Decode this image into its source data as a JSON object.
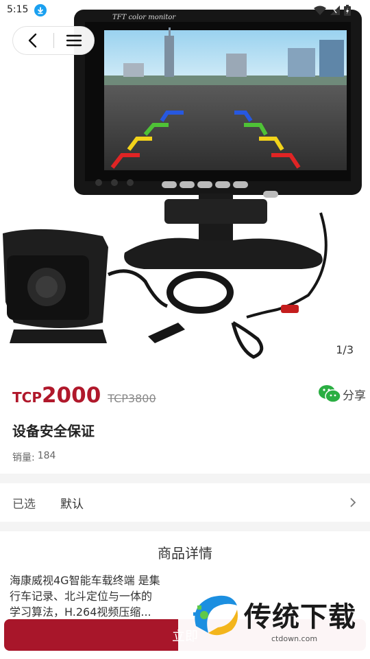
{
  "status_bar": {
    "time": "5:15",
    "icons": [
      "download-icon",
      "wifi-icon",
      "signal-icon",
      "battery-icon"
    ]
  },
  "nav": {
    "back_icon": "chevron-left-icon",
    "menu_icon": "menu-icon"
  },
  "hero": {
    "monitor_label": "TFT color monitor",
    "image_counter": "1/3"
  },
  "product": {
    "currency": "TCP",
    "price": "2000",
    "original_price": "TCP3800",
    "title": "设备安全保证",
    "sales_label": "销量:",
    "sales_count": "184"
  },
  "share": {
    "icon": "wechat-icon",
    "label": "分享"
  },
  "selection": {
    "label": "已选",
    "value": "默认"
  },
  "details": {
    "title": "商品详情",
    "body_lines": [
      "海康威视4G智能车载终端 是集",
      "行车记录、北斗定位与一体的",
      "学习算法，H.264视频压缩..."
    ]
  },
  "buy_button": {
    "label": "立即"
  },
  "watermark": {
    "text": "传统下载",
    "site": "ctdown.com"
  },
  "colors": {
    "accent": "#a8162a",
    "price": "#b0182b",
    "wechat": "#2aae42"
  }
}
